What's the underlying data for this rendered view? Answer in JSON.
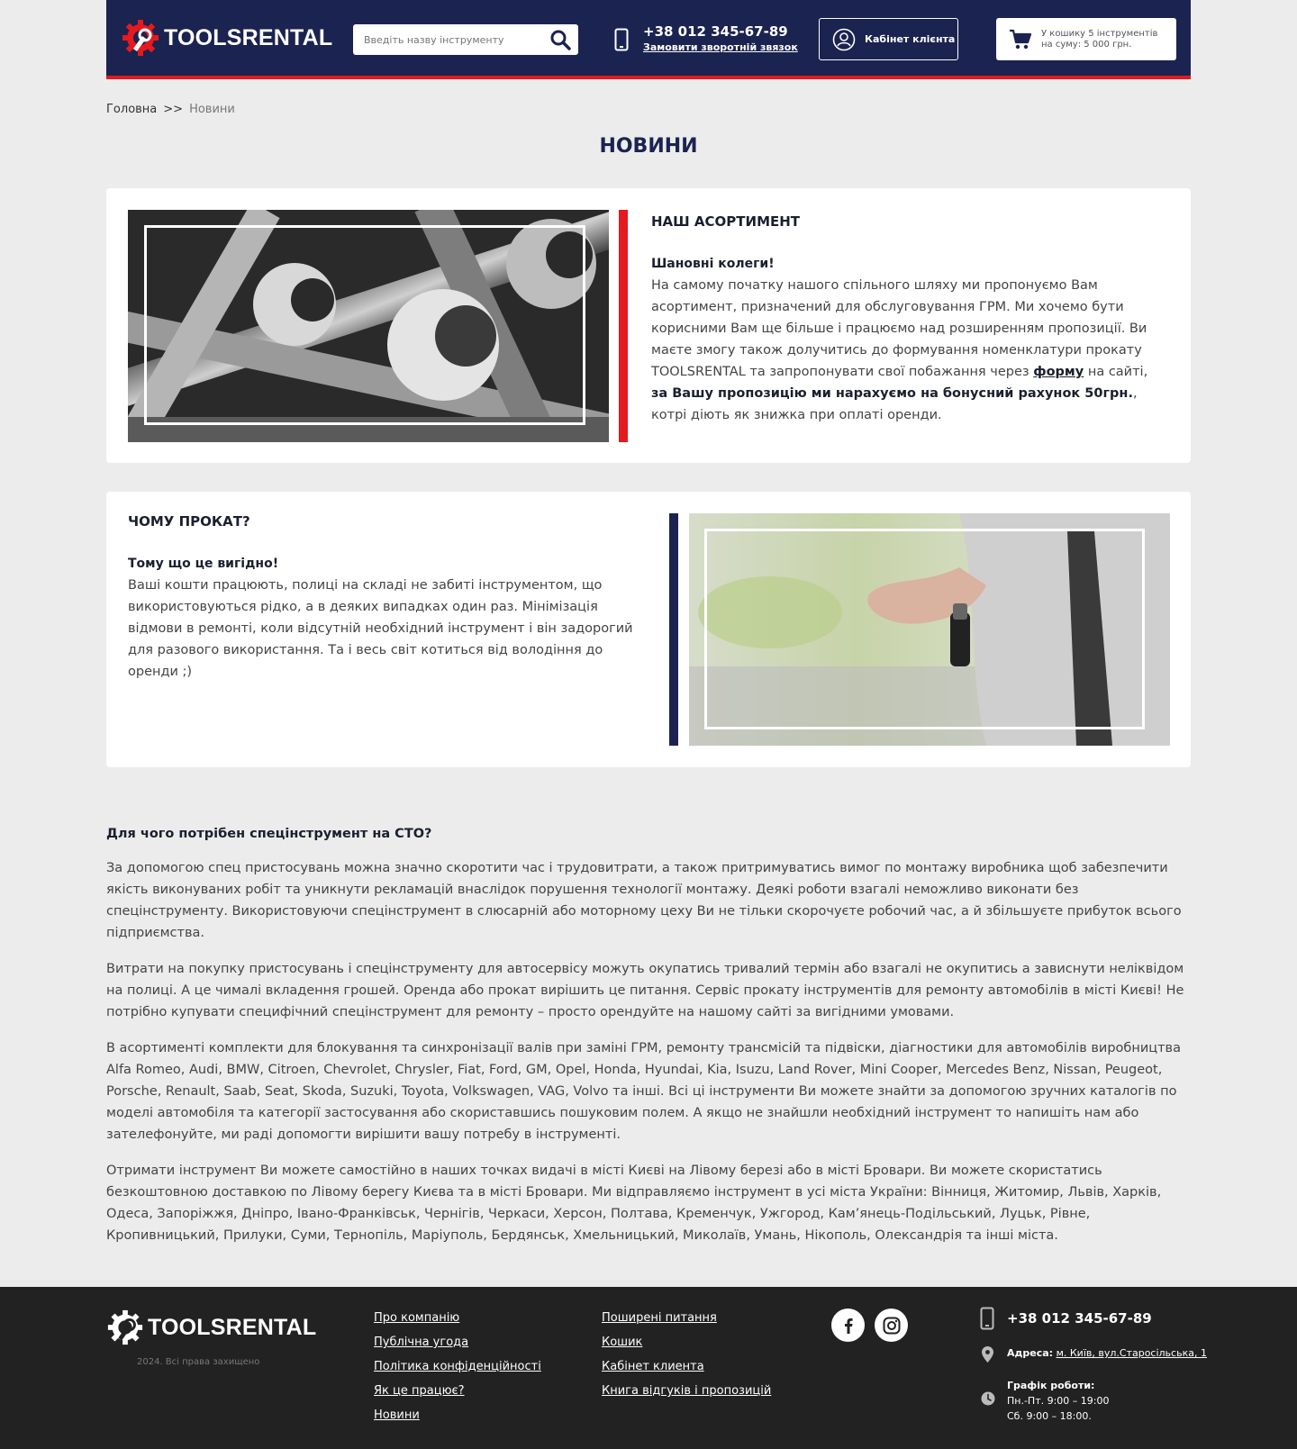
{
  "header": {
    "logo_text": "TOOLSRENTAL",
    "search_placeholder": "Введіть назву інструменту",
    "phone": "+38 012 345-67-89",
    "callback_link": "Замовити зворотній звязок",
    "cabinet_label": "Кабінет клієнта",
    "cart_text": "У кошику 5 інструментів на суму: 5 000 грн."
  },
  "breadcrumb": {
    "home": "Головна",
    "separator": ">>",
    "current": "Новини"
  },
  "page_title": "НОВИНИ",
  "card1": {
    "heading": "НАШ АСОРТИМЕНТ",
    "subheading": "Шановні колеги!",
    "text_before_link": "На самому початку нашого спільного шляху ми пропонуємо Вам асортимент, призначений для обслуговування ГРМ. Ми хочемо бути корисними Вам ще більше і працюємо над розширенням пропозиції. Ви маєте змогу також долучитись до формування номенклатури прокату TOOLSRENTAL та запропонувати свої побажання через ",
    "link_text": "форму",
    "text_after_link": " на сайті, ",
    "bold_text": "за Вашу пропозицію ми нарахуємо на бонусний рахунок 50грн.",
    "text_end": ", котрі діють як знижка при оплаті оренди."
  },
  "card2": {
    "heading": "ЧОМУ ПРОКАТ?",
    "subheading": "Тому що це вигідно!",
    "text": "Ваші кошти працюють, полиці на складі не забиті інструментом, що використовуються рідко, а в деяких випадках один раз. Мінімізація відмови в ремонті, коли відсутній необхідний інструмент і він задорогий для разового використання. Та і весь світ котиться від володіння до оренди ;)"
  },
  "article": {
    "heading": "Для чого потрібен спецінструмент на СТО?",
    "paragraphs": [
      "За допомогою спец пристосувань можна значно скоротити час і трудовитрати, а також притримуватись вимог по монтажу виробника щоб забезпечити якість виконуваних робіт та уникнути рекламацій внаслідок порушення технології монтажу. Деякі роботи взагалі неможливо виконати без спецінструменту. Використовуючи спецінструмент в слюсарній або моторному цеху Ви не тільки скорочуєте робочий час, а й збільшуєте прибуток всього підприємства.",
      "Витрати на покупку пристосувань і спецінструменту для автосервісу можуть окупатись тривалий термін або взагалі не окупитись а зависнути неліквідом на полиці. А це чималі вкладення грошей. Оренда або прокат вирішить це питання. Сервіс прокату інструментів для ремонту автомобілів в місті Києві! Не потрібно купувати специфічний спецінструмент для ремонту – просто орендуйте на нашому сайті за вигідними умовами.",
      "В асортименті комплекти для блокування та синхронізації валів при заміні ГРМ, ремонту трансмісій та підвіски, діагностики для автомобілів виробництва Alfa Romeo, Audi, BMW, Citroen, Chevrolet, Chrysler, Fiat, Ford, GM, Opel, Honda, Hyundai, Kia, Isuzu, Land Rover, Mini Cooper, Mercedes Benz, Nissan, Peugeot, Porsche, Renault, Saab, Seat, Skoda, Suzuki, Toyota, Volkswagen, VAG, Volvo та інші. Всі ці інструменти Ви можете знайти за допомогою зручних каталогів по моделі автомобіля та категорії застосування або скориставшись пошуковим полем. А якщо не знайшли необхідний інструмент то напишіть нам або зателефонуйте, ми раді допомогти вирішити вашу потребу в інструменті.",
      "Отримати інструмент Ви можете самостійно в наших точках видачі в місті Києві на Лівому березі або в місті Бровари. Ви можете скористатись безкоштовною доставкою по Лівому берегу Києва та в місті Бровари. Ми відправляємо інструмент в усі міста України: Вінниця, Житомир, Львів, Харків, Одеса, Запоріжжя, Дніпро, Івано-Франківськ, Чернігів, Черкаси, Херсон, Полтава, Кременчук, Ужгород, Кам’янець-Подільський, Луцьк, Рівне, Кропивницький, Прилуки, Суми, Тернопіль, Маріуполь, Бердянськ, Хмельницький, Миколаїв, Умань, Нікополь, Олександрія та інші міста."
    ]
  },
  "footer": {
    "logo_text": "TOOLSRENTAL",
    "copyright": "2024. Всі права захищено",
    "col1": [
      "Про компанію",
      "Публічна угода",
      "Політика конфіденційності",
      "Як це працює?",
      "Новини"
    ],
    "col2": [
      "Поширені питання",
      "Кошик",
      "Кабінет клиента",
      "Книга відгуків і пропозицій"
    ],
    "phone": "+38 012 345-67-89",
    "address_label": "Адреса:",
    "address": "м. Київ, вул.Старосільська, 1",
    "schedule_label": "Графік роботи:",
    "schedule_weekdays": "Пн.-Пт. 9:00 – 19:00",
    "schedule_saturday": "Сб. 9:00 – 18:00."
  },
  "colors": {
    "brand_navy": "#1b2350",
    "accent_red": "#e41a1f",
    "footer_bg": "#222222",
    "page_bg": "#ececec"
  },
  "icons": [
    "gear-wrench-logo-icon",
    "search-icon",
    "mobile-phone-icon",
    "user-circle-icon",
    "cart-icon",
    "facebook-icon",
    "instagram-icon",
    "map-pin-icon",
    "clock-icon"
  ]
}
